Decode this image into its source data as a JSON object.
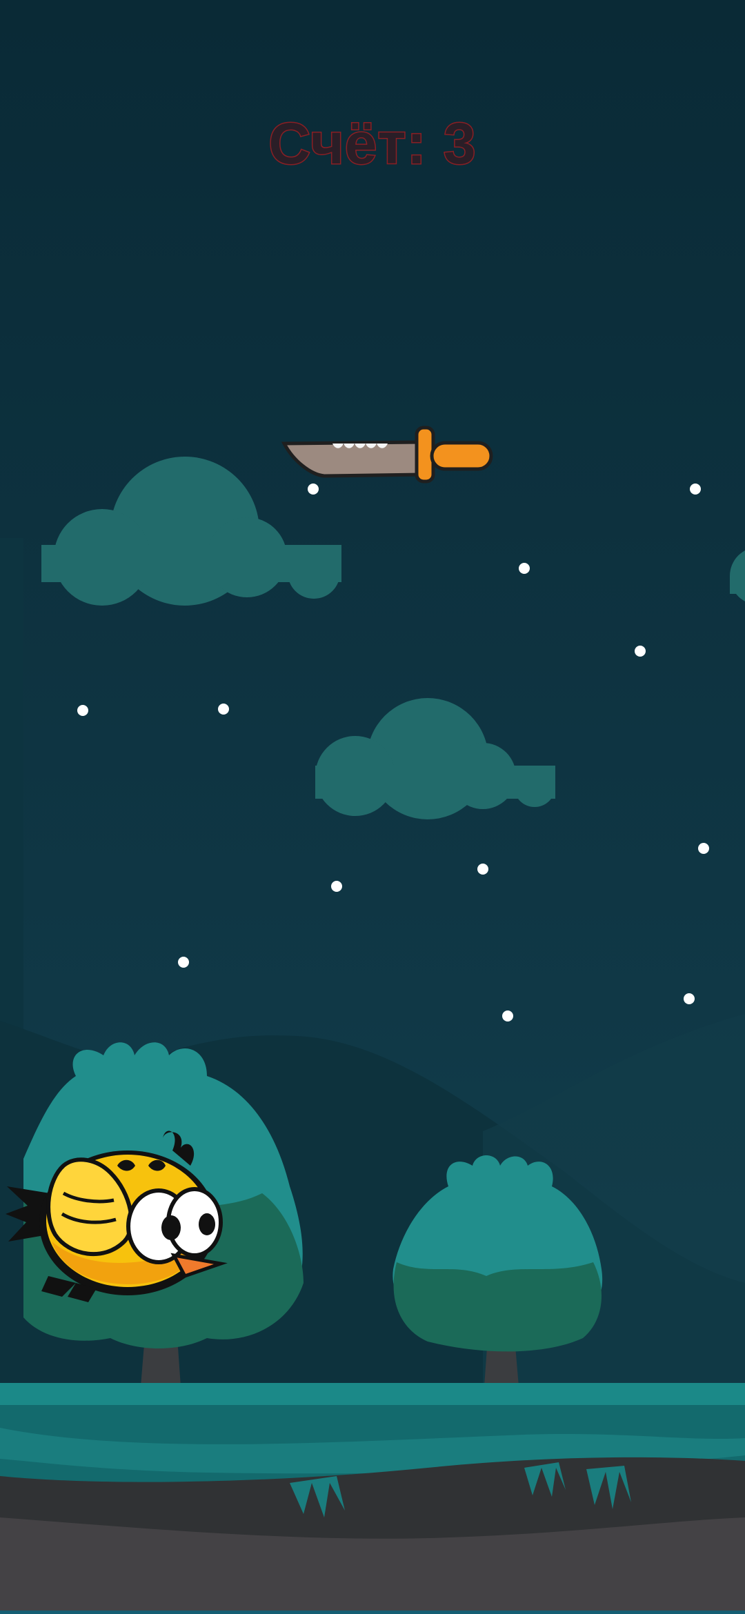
{
  "hud": {
    "score_text": "Счёт: 3",
    "score_value": 3
  },
  "colors": {
    "sky": "#0b2c38",
    "sky_lower": "#123f4c",
    "cloud": "#226b6b",
    "star": "#ffffff",
    "hill": "#0e3641",
    "tree_light": "#218e8c",
    "tree_dark": "#1b6a58",
    "trunk": "#3b3d40",
    "grass_top": "#1b8988",
    "grass_mid": "#136a6d",
    "soil_dark": "#303234",
    "soil": "#444245",
    "score_fill": "#2a1e27",
    "score_stroke": "#8a1f24",
    "bird_body": "#f7c20d",
    "bird_belly": "#f2a20e",
    "bird_beak": "#f07a2c",
    "blade": "#9c8a80",
    "knife_handle": "#f3921e"
  },
  "sprites": {
    "player": "yellow-bird-icon",
    "obstacle": "knife-icon",
    "decor": [
      "cloud-icon",
      "star-icon",
      "tree-icon",
      "hill-icon"
    ]
  }
}
